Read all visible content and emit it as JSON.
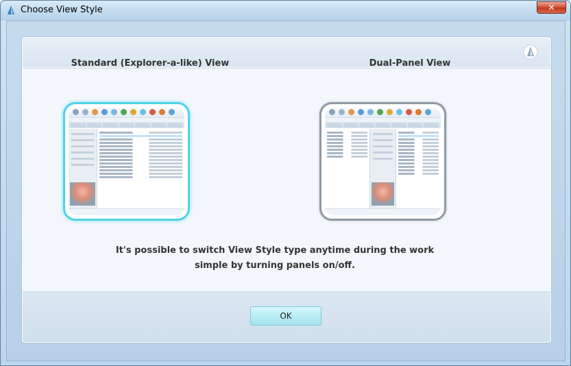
{
  "window": {
    "title": "Choose View Style",
    "close_label": "✕"
  },
  "options": [
    {
      "title": "Standard (Explorer-a-like) View",
      "selected": true
    },
    {
      "title": "Dual-Panel View",
      "selected": false
    }
  ],
  "message": {
    "line1": "It's possible to switch View Style type anytime during the work",
    "line2": "simple by turning panels on/off."
  },
  "ok_label": "OK",
  "colors": {
    "selected_border": "#4fd3e9",
    "unselected_border": "#909aa6",
    "ok_button": "#b9ecf5"
  },
  "icons": {
    "app": "app-logo-icon",
    "brand": "brand-logo-icon",
    "close": "close-icon"
  }
}
